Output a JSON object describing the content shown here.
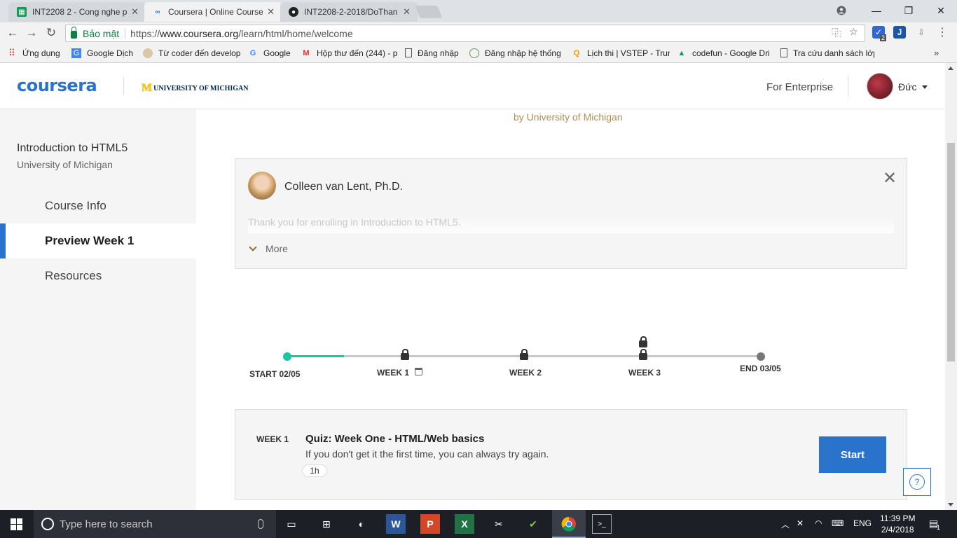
{
  "browser": {
    "tabs": [
      {
        "title": "INT2208 2 - Cong nghe p",
        "icon": "sheets-icon"
      },
      {
        "title": "Coursera | Online Course",
        "icon": "coursera-icon"
      },
      {
        "title": "INT2208-2-2018/DoThan",
        "icon": "github-icon"
      }
    ],
    "secure_label": "Bảo mật",
    "url_prefix": "https://",
    "url_host": "www.coursera.org",
    "url_path": "/learn/html/home/welcome",
    "bookmarks": [
      {
        "label": "Ứng dụng",
        "icon": "apps-icon"
      },
      {
        "label": "Google Dịch",
        "icon": "translate-icon"
      },
      {
        "label": "Từ coder đến develop",
        "icon": "bookmark-icon"
      },
      {
        "label": "Google",
        "icon": "google-icon"
      },
      {
        "label": "Hộp thư đến (244) - p",
        "icon": "gmail-icon"
      },
      {
        "label": "Đăng nhập",
        "icon": "page-icon"
      },
      {
        "label": "Đăng nhập hệ thống",
        "icon": "globe-icon"
      },
      {
        "label": "Lịch thi | VSTEP - Trun",
        "icon": "bookmark-icon"
      },
      {
        "label": "codefun - Google Dri",
        "icon": "drive-icon"
      },
      {
        "label": "Tra cứu danh sách lớp",
        "icon": "page-icon"
      }
    ],
    "extension_badge": "2"
  },
  "header": {
    "logo": "coursera",
    "partner_initial": "M",
    "partner": "UNIVERSITY OF MICHIGAN",
    "enterprise_link": "For Enterprise",
    "user_name": "Đức"
  },
  "sidebar": {
    "course_title": "Introduction to HTML5",
    "course_org": "University of Michigan",
    "items": [
      {
        "label": "Course Info",
        "active": false
      },
      {
        "label": "Preview Week 1",
        "active": true
      },
      {
        "label": "Resources",
        "active": false
      }
    ]
  },
  "main": {
    "byline": "by University of Michigan",
    "instructor": {
      "name": "Colleen van Lent, Ph.D.",
      "message": "Thank you for enrolling in Introduction to HTML5.",
      "more_label": "More"
    },
    "timeline": {
      "start_label": "START 02/05",
      "end_label": "END 03/05",
      "weeks": [
        "WEEK 1",
        "WEEK 2",
        "WEEK 3"
      ],
      "progress_fraction": 0.12
    },
    "week_card": {
      "tag": "WEEK 1",
      "title": "Quiz: Week One - HTML/Web basics",
      "description": "If you don't get it the first time, you can always try again.",
      "duration": "1h",
      "button": "Start"
    },
    "help_label": "?"
  },
  "taskbar": {
    "search_placeholder": "Type here to search",
    "language": "ENG",
    "time": "11:39 PM",
    "date": "2/4/2018",
    "notification_count": "1"
  },
  "colors": {
    "accent": "#2a73cc",
    "progress": "#1fc2a1",
    "byline": "#b08d57"
  }
}
